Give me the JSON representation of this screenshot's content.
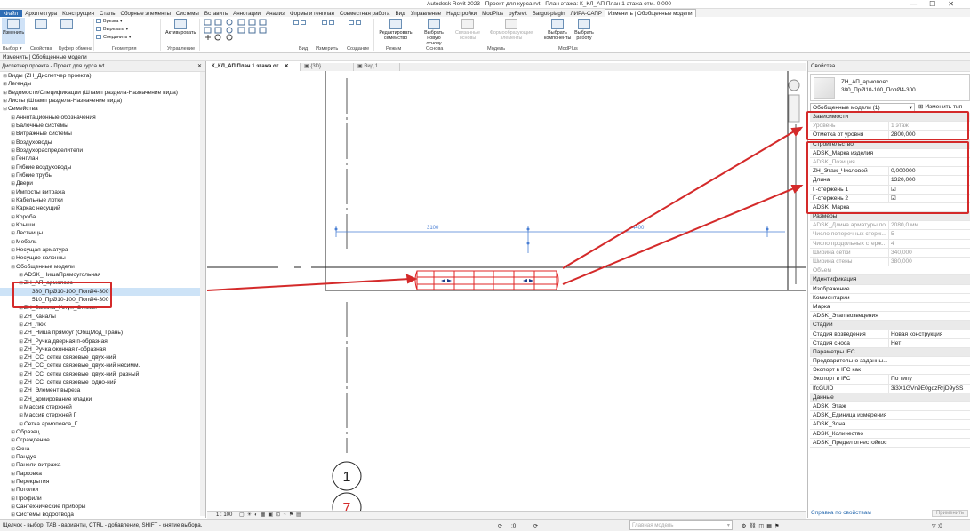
{
  "title": "Autodesk Revit 2023 - Проект для курса.rvt - План этажа: К_КЛ_АП План 1 этажа отм. 0,000",
  "menu": [
    "Файл",
    "Архитектура",
    "Конструкция",
    "Сталь",
    "Сборные элементы",
    "Системы",
    "Вставить",
    "Аннотации",
    "Анализ",
    "Формы и генплан",
    "Совместная работа",
    "Вид",
    "Управление",
    "Надстройки",
    "ModPlus",
    "pyRevit",
    "Bargot-plagin",
    "ЛИРА-САПР",
    "Изменить | Обобщенные модели"
  ],
  "ribbon": {
    "modify": "Изменить",
    "select": "Выбор ▾",
    "props": "Свойства",
    "clipboard": "Буфер обмена",
    "cut": "Врезка ▾",
    "cutout": "Вырезать ▾",
    "join": "Соединить ▾",
    "geometry": "Геометрия",
    "activate": "Активировать",
    "manage": "Управление",
    "view": "Вид",
    "measure": "Измерить",
    "create": "Создание",
    "edit_family": "Редактировать семейство",
    "mode": "Режим",
    "pick_host": "Выбрать новую основу",
    "host": "Основа",
    "related_hosts": "Связанные основы",
    "formwork": "Формообразующие элементы",
    "model": "Модель",
    "pick_components": "Выбрать компоненты",
    "pick_work": "Выбрать работу",
    "modplus": "ModPlus"
  },
  "context_bar": "Изменить | Обобщенные модели",
  "browser": {
    "header": "Диспетчер проекта - Проект для курса.rvt",
    "items": [
      {
        "t": "⊟",
        "l": "Виды (ZH_Диспетчер проекта)",
        "i": 0
      },
      {
        "t": "⊞",
        "l": "Легенды",
        "i": 0
      },
      {
        "t": "⊞",
        "l": "Ведомости/Спецификации (Штамп раздела-Назначение вида)",
        "i": 0
      },
      {
        "t": "⊞",
        "l": "Листы (Штамп раздела-Назначение вида)",
        "i": 0
      },
      {
        "t": "⊟",
        "l": "Семейства",
        "i": 0
      },
      {
        "t": "⊞",
        "l": "Аннотационные обозначения",
        "i": 1
      },
      {
        "t": "⊞",
        "l": "Балочные системы",
        "i": 1
      },
      {
        "t": "⊞",
        "l": "Витражные системы",
        "i": 1
      },
      {
        "t": "⊞",
        "l": "Воздуховоды",
        "i": 1
      },
      {
        "t": "⊞",
        "l": "Воздухораспределители",
        "i": 1
      },
      {
        "t": "⊞",
        "l": "Генплан",
        "i": 1
      },
      {
        "t": "⊞",
        "l": "Гибкие воздуховоды",
        "i": 1
      },
      {
        "t": "⊞",
        "l": "Гибкие трубы",
        "i": 1
      },
      {
        "t": "⊞",
        "l": "Двери",
        "i": 1
      },
      {
        "t": "⊞",
        "l": "Импосты витража",
        "i": 1
      },
      {
        "t": "⊞",
        "l": "Кабельные лотки",
        "i": 1
      },
      {
        "t": "⊞",
        "l": "Каркас несущий",
        "i": 1
      },
      {
        "t": "⊞",
        "l": "Короба",
        "i": 1
      },
      {
        "t": "⊞",
        "l": "Крыши",
        "i": 1
      },
      {
        "t": "⊞",
        "l": "Лестницы",
        "i": 1
      },
      {
        "t": "⊞",
        "l": "Мебель",
        "i": 1
      },
      {
        "t": "⊞",
        "l": "Несущая арматура",
        "i": 1
      },
      {
        "t": "⊞",
        "l": "Несущие колонны",
        "i": 1
      },
      {
        "t": "⊟",
        "l": "Обобщенные модели",
        "i": 1
      },
      {
        "t": "⊞",
        "l": "ADSK_НишаПрямоугольная",
        "i": 2
      },
      {
        "t": "⊟",
        "l": "ZH_АП_армопояс",
        "i": 2
      },
      {
        "t": "",
        "l": "380_ПрØ10-100_ПопØ4-300",
        "i": 3
      },
      {
        "t": "",
        "l": "510_ПрØ10-100_ПопØ4-300",
        "i": 3
      },
      {
        "t": "⊞",
        "l": "ZH_Высота_Уступ_Стяжки",
        "i": 2
      },
      {
        "t": "⊞",
        "l": "ZH_Каналы",
        "i": 2
      },
      {
        "t": "⊞",
        "l": "ZH_Люк",
        "i": 2
      },
      {
        "t": "⊞",
        "l": "ZH_Ниша прямоуг (ОбщМод_Грань)",
        "i": 2
      },
      {
        "t": "⊞",
        "l": "ZH_Ручка дверная п-образная",
        "i": 2
      },
      {
        "t": "⊞",
        "l": "ZH_Ручка оконная г-образная",
        "i": 2
      },
      {
        "t": "⊞",
        "l": "ZH_СС_сетки связевые_двух-ний",
        "i": 2
      },
      {
        "t": "⊞",
        "l": "ZH_СС_сетки связевые_двух-ний несимм.",
        "i": 2
      },
      {
        "t": "⊞",
        "l": "ZH_СС_сетки связевые_двух-ний_разный",
        "i": 2
      },
      {
        "t": "⊞",
        "l": "ZH_СС_сетки связевые_одно-ний",
        "i": 2
      },
      {
        "t": "⊞",
        "l": "ZH_Элемент выреза",
        "i": 2
      },
      {
        "t": "⊞",
        "l": "ZH_армирование кладки",
        "i": 2
      },
      {
        "t": "⊞",
        "l": "Массив стержней",
        "i": 2
      },
      {
        "t": "⊞",
        "l": "Массив стержней Г",
        "i": 2
      },
      {
        "t": "⊞",
        "l": "Сетка армопояса_Г",
        "i": 2
      },
      {
        "t": "⊞",
        "l": "Образец",
        "i": 1
      },
      {
        "t": "⊞",
        "l": "Ограждение",
        "i": 1
      },
      {
        "t": "⊞",
        "l": "Окна",
        "i": 1
      },
      {
        "t": "⊞",
        "l": "Пандус",
        "i": 1
      },
      {
        "t": "⊞",
        "l": "Панели витража",
        "i": 1
      },
      {
        "t": "⊞",
        "l": "Парковка",
        "i": 1
      },
      {
        "t": "⊞",
        "l": "Перекрытия",
        "i": 1
      },
      {
        "t": "⊞",
        "l": "Потолки",
        "i": 1
      },
      {
        "t": "⊞",
        "l": "Профили",
        "i": 1
      },
      {
        "t": "⊞",
        "l": "Сантехнические приборы",
        "i": 1
      },
      {
        "t": "⊞",
        "l": "Системы водоотвода",
        "i": 1
      }
    ]
  },
  "tabs": {
    "active": "К_КЛ_АП План 1 этажа от...",
    "t3d": "{3D}",
    "view1": "Вид 1"
  },
  "canvas": {
    "dim1": "3100",
    "dim2": "4400",
    "grid1": "1",
    "grid2": "7"
  },
  "viewbar": {
    "scale": "1 : 100"
  },
  "props": {
    "header": "Свойства",
    "type_name": "ZH_АП_армопояс\n380_ПрØ10-100_ПопØ4-300",
    "filter": "Обобщенные модели (1)",
    "edit_type": "Изменить тип",
    "rows": [
      {
        "g": "Зависимости"
      },
      {
        "k": "Уровень",
        "v": "1 этаж",
        "d": true
      },
      {
        "k": "Отметка от уровня",
        "v": "2800,000"
      },
      {
        "g": "Строительство"
      },
      {
        "k": "ADSK_Марка изделия",
        "v": ""
      },
      {
        "k": "ADSK_Позиция",
        "v": "",
        "d": true
      },
      {
        "k": "ZH_Этаж_Числовой",
        "v": "0,000000"
      },
      {
        "k": "Длина",
        "v": "1320,000"
      },
      {
        "k": "Г-стержень 1",
        "v": "☑"
      },
      {
        "k": "Г-стержень 2",
        "v": "☑"
      },
      {
        "k": "ADSK_Марка",
        "v": ""
      },
      {
        "g": "Размеры"
      },
      {
        "k": "ADSK_Длина арматуры по ...",
        "v": "2080,0 мм",
        "d": true
      },
      {
        "k": "Число поперечных стерж...",
        "v": "5",
        "d": true
      },
      {
        "k": "Число продольных стерж...",
        "v": "4",
        "d": true
      },
      {
        "k": "Ширина сетки",
        "v": "340,000",
        "d": true
      },
      {
        "k": "Ширина стены",
        "v": "380,000",
        "d": true
      },
      {
        "k": "Объем",
        "v": "",
        "d": true
      },
      {
        "g": "Идентификация"
      },
      {
        "k": "Изображение",
        "v": ""
      },
      {
        "k": "Комментарии",
        "v": ""
      },
      {
        "k": "Марка",
        "v": ""
      },
      {
        "k": "ADSK_Этап возведения",
        "v": ""
      },
      {
        "g": "Стадии"
      },
      {
        "k": "Стадия возведения",
        "v": "Новая конструкция"
      },
      {
        "k": "Стадия сноса",
        "v": "Нет"
      },
      {
        "g": "Параметры IFC"
      },
      {
        "k": "Предварительно заданны...",
        "v": ""
      },
      {
        "k": "Экспорт в IFC как",
        "v": ""
      },
      {
        "k": "Экспорт в IFC",
        "v": "По типу"
      },
      {
        "k": "IfcGUID",
        "v": "3i3X1GVn9E0gqzRrjD9ySS"
      },
      {
        "g": "Данные"
      },
      {
        "k": "ADSK_Этаж",
        "v": ""
      },
      {
        "k": "ADSK_Единица измерения",
        "v": ""
      },
      {
        "k": "ADSK_Зона",
        "v": ""
      },
      {
        "k": "ADSK_Количество",
        "v": ""
      },
      {
        "k": "ADSK_Предел огнестойкос...",
        "v": ""
      }
    ],
    "help": "Справка по свойствам",
    "apply": "Применить"
  },
  "status": {
    "hint": "Щелчок - выбор, TAB - варианты, CTRL - добавление, SHIFT - снятие выбора.",
    "model": "Главная модель",
    "zero": ":0"
  },
  "colors": {
    "accent": "#2f6db5",
    "highlight": "#d42a2a",
    "dim": "#4a7fd4"
  }
}
